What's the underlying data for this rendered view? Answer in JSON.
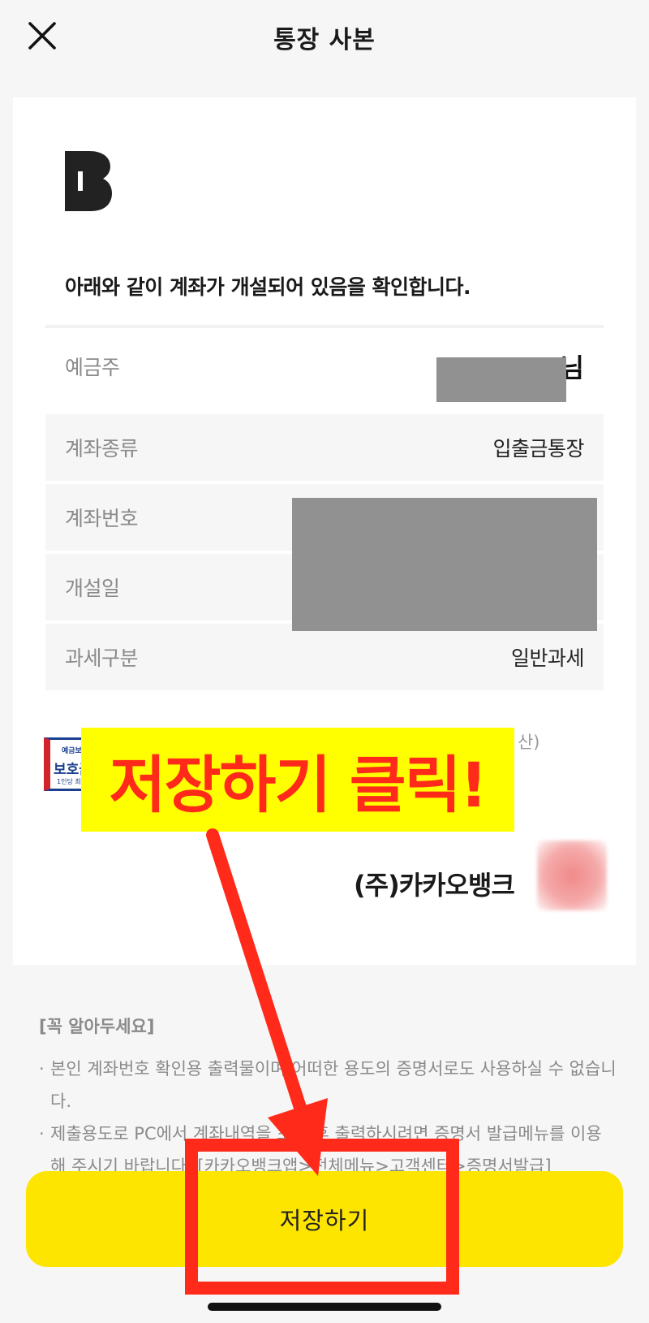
{
  "header": {
    "title": "통장 사본"
  },
  "card": {
    "confirm_text": "아래와 같이 계좌가 개설되어 있음을 확인합니다.",
    "rows": [
      {
        "label": "예금주",
        "value": "",
        "suffix": "님"
      },
      {
        "label": "계좌종류",
        "value": "입출금통장"
      },
      {
        "label": "계좌번호",
        "value": ""
      },
      {
        "label": "개설일",
        "value": ""
      },
      {
        "label": "과세구분",
        "value": "일반과세"
      }
    ],
    "deposit_badge": {
      "line1": "예금보",
      "line2": "보호금",
      "line3": "1인당 최"
    },
    "deposit_text": "자를 합하여 산)",
    "company": "(주)카카오뱅크"
  },
  "notice": {
    "title": "[꼭 알아두세요]",
    "items": [
      "본인 계좌번호 확인용 출력물이며 어떠한 용도의 증명서로도 사용하실 수 없습니다.",
      "제출용도로 PC에서 계좌내역을 조회 후 출력하시려면 증명서 발급메뉴를 이용해 주시기 바랍니다. [카카오뱅크앱>전체메뉴>고객센터>증명서발급]"
    ]
  },
  "save_button": {
    "label": "저장하기"
  },
  "annotation": {
    "text": "저장하기 클릭!",
    "color": "#ff2a1a",
    "background": "#ffff00"
  },
  "colors": {
    "accent": "#fee500",
    "background": "#f6f6f6",
    "redaction": "#919191"
  }
}
